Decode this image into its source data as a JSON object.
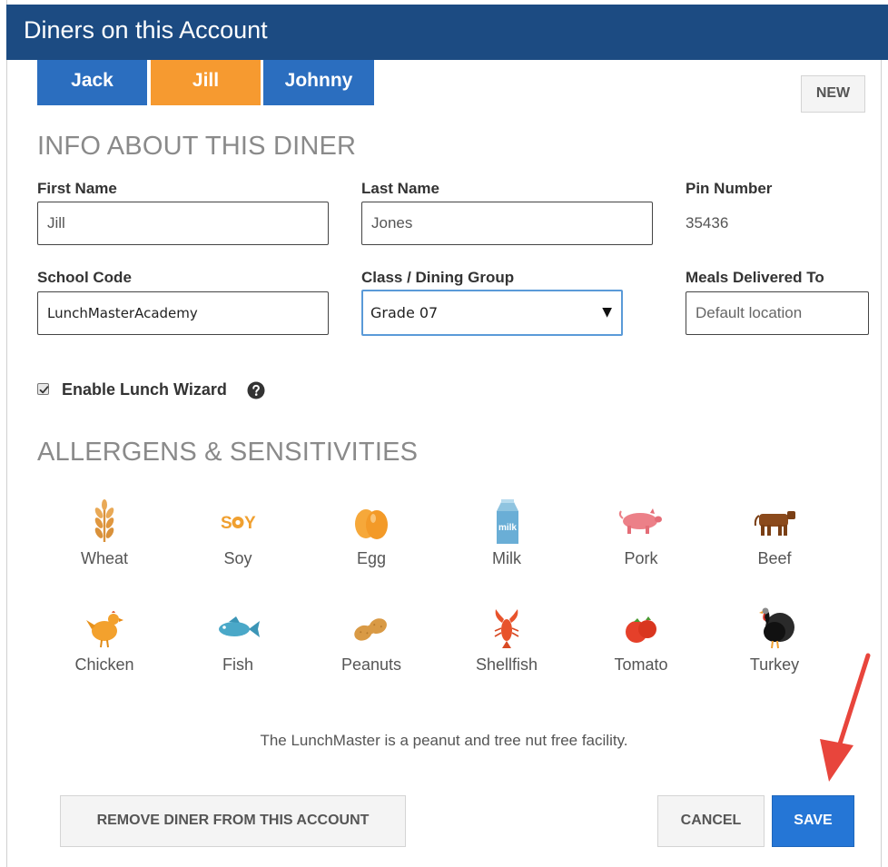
{
  "header": {
    "title": "Diners on this Account"
  },
  "tabs": [
    {
      "label": "Jack",
      "state": "inactive"
    },
    {
      "label": "Jill",
      "state": "active"
    },
    {
      "label": "Johnny",
      "state": "inactive"
    }
  ],
  "new_button": "NEW",
  "info_section": {
    "title": "INFO ABOUT THIS DINER",
    "first_name": {
      "label": "First Name",
      "value": "Jill"
    },
    "last_name": {
      "label": "Last Name",
      "value": "Jones"
    },
    "pin_number": {
      "label": "Pin Number",
      "value": "35436"
    },
    "school_code": {
      "label": "School Code",
      "value": "LunchMasterAcademy"
    },
    "class_group": {
      "label": "Class / Dining Group",
      "value": "Grade 07"
    },
    "meals_delivered": {
      "label": "Meals Delivered To",
      "placeholder": "Default location"
    },
    "lunch_wizard": {
      "label": "Enable Lunch Wizard",
      "checked": true
    }
  },
  "allergens_section": {
    "title": "ALLERGENS & SENSITIVITIES",
    "items": [
      {
        "name": "Wheat",
        "icon": "wheat-icon"
      },
      {
        "name": "Soy",
        "icon": "soy-icon",
        "icon_text": "S",
        "icon_text2": "Y"
      },
      {
        "name": "Egg",
        "icon": "egg-icon"
      },
      {
        "name": "Milk",
        "icon": "milk-icon",
        "icon_text": "milk"
      },
      {
        "name": "Pork",
        "icon": "pork-icon"
      },
      {
        "name": "Beef",
        "icon": "beef-icon"
      },
      {
        "name": "Chicken",
        "icon": "chicken-icon"
      },
      {
        "name": "Fish",
        "icon": "fish-icon"
      },
      {
        "name": "Peanuts",
        "icon": "peanuts-icon"
      },
      {
        "name": "Shellfish",
        "icon": "shellfish-icon"
      },
      {
        "name": "Tomato",
        "icon": "tomato-icon"
      },
      {
        "name": "Turkey",
        "icon": "turkey-icon"
      }
    ]
  },
  "facility_note": "The LunchMaster is a peanut and tree nut free facility.",
  "actions": {
    "remove_label": "REMOVE DINER FROM THIS ACCOUNT",
    "cancel_label": "CANCEL",
    "save_label": "SAVE"
  },
  "colors": {
    "header_bg": "#1c4b82",
    "tab_blue": "#2b6ebf",
    "tab_active": "#f69a30",
    "primary_button": "#2576d6",
    "annotation_arrow": "#e8453c"
  }
}
